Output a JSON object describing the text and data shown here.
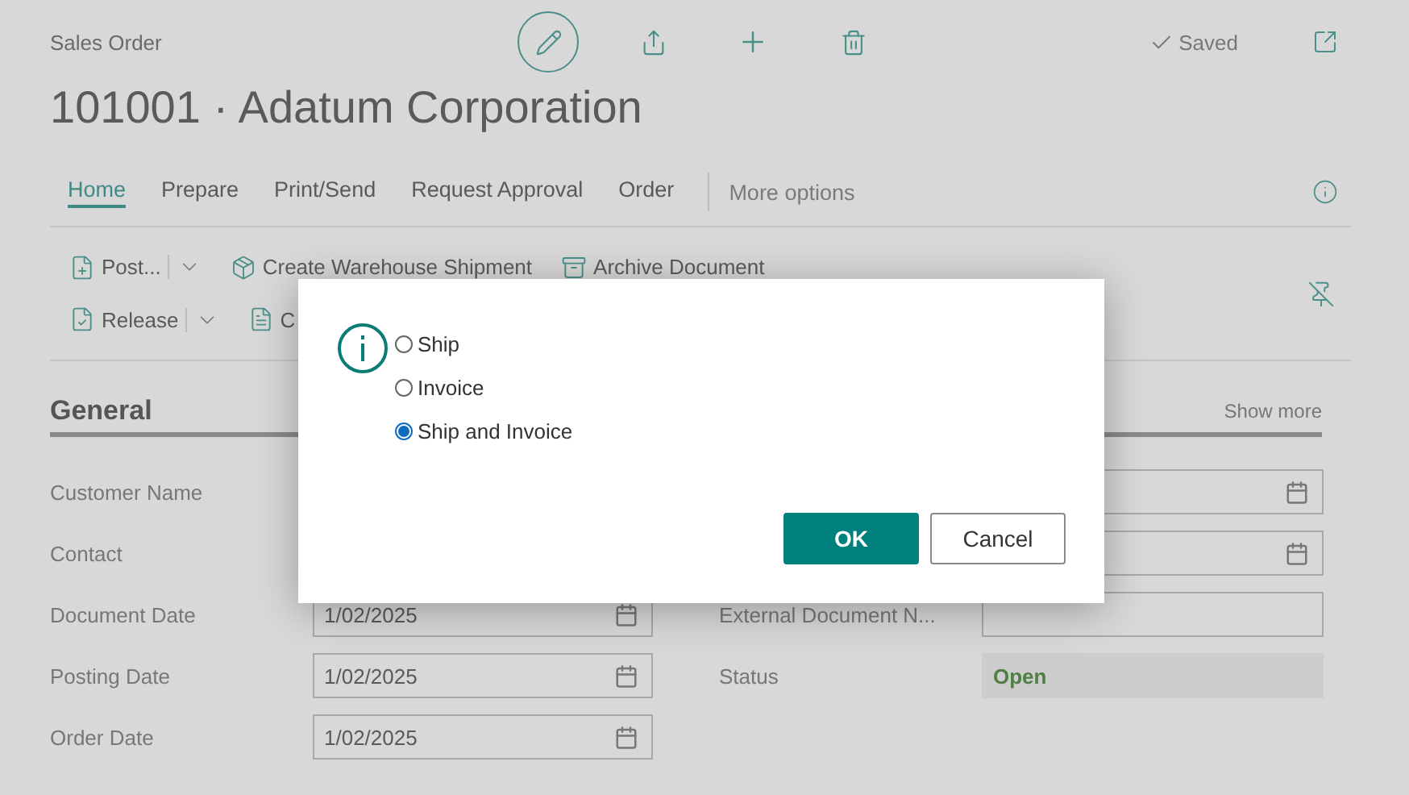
{
  "header": {
    "caption": "Sales Order",
    "title": "101001 · Adatum Corporation",
    "saved": "Saved"
  },
  "tabs": [
    {
      "label": "Home",
      "selected": true
    },
    {
      "label": "Prepare",
      "selected": false
    },
    {
      "label": "Print/Send",
      "selected": false
    },
    {
      "label": "Request Approval",
      "selected": false
    },
    {
      "label": "Order",
      "selected": false
    }
  ],
  "more_options": "More options",
  "actions": [
    [
      {
        "label": "Post...",
        "kind": "split"
      },
      {
        "label": "Create Warehouse Shipment",
        "kind": "plain"
      },
      {
        "label": "Archive Document",
        "kind": "plain"
      }
    ],
    [
      {
        "label": "Release",
        "kind": "split"
      },
      {
        "label": "C",
        "kind": "plain"
      }
    ]
  ],
  "section": {
    "title": "General",
    "show_more": "Show more"
  },
  "rows": [
    {
      "left": {
        "label": "Customer Name",
        "kind": "none"
      },
      "right": {
        "kind": "date"
      }
    },
    {
      "left": {
        "label": "Contact",
        "kind": "none"
      },
      "right": {
        "kind": "date"
      }
    },
    {
      "left": {
        "label": "Document Date",
        "kind": "date",
        "value": "1/02/2025"
      },
      "right": {
        "label": "External Document N...",
        "kind": "text"
      }
    },
    {
      "left": {
        "label": "Posting Date",
        "kind": "date",
        "value": "1/02/2025"
      },
      "right": {
        "label": "Status",
        "kind": "status",
        "value": "Open"
      }
    },
    {
      "left": {
        "label": "Order Date",
        "kind": "date",
        "value": "1/02/2025"
      }
    }
  ],
  "dialog": {
    "options": [
      {
        "label": "Ship",
        "selected": false
      },
      {
        "label": "Invoice",
        "selected": false
      },
      {
        "label": "Ship and Invoice",
        "selected": true
      }
    ],
    "buttons": [
      {
        "label": "OK",
        "kind": "primary"
      },
      {
        "label": "Cancel",
        "kind": "secondary"
      }
    ]
  }
}
